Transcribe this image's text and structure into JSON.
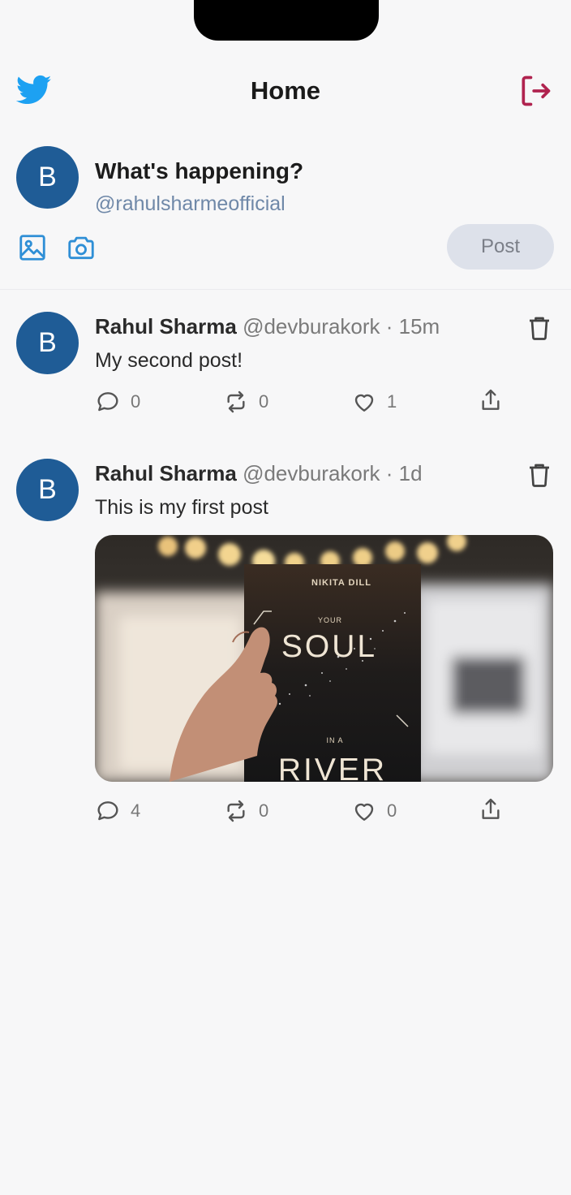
{
  "header": {
    "title": "Home",
    "logo_icon": "twitter-bird-icon",
    "logout_icon": "logout-icon",
    "accent_color": "#1da1f2",
    "logout_color": "#b0234f"
  },
  "composer": {
    "avatar_letter": "B",
    "prompt": "What's happening?",
    "handle": "@rahulsharmeofficial",
    "post_label": "Post",
    "tools": [
      "image-icon",
      "camera-icon"
    ]
  },
  "posts": [
    {
      "avatar_letter": "B",
      "name": "Rahul Sharma",
      "meta": "@devburakork · 15m",
      "text": "My second post!",
      "actions": {
        "comments": "0",
        "reposts": "0",
        "likes": "1"
      }
    },
    {
      "avatar_letter": "B",
      "name": "Rahul Sharma",
      "meta": "@devburakork · 1d",
      "text": "This is my first post",
      "image": {
        "author": "NIKITA DILL",
        "title_line1": "YOUR",
        "title_line2": "SOUL",
        "title_line3": "IN A",
        "title_line4": "RIVER"
      },
      "actions": {
        "comments": "4",
        "reposts": "0",
        "likes": "0"
      }
    }
  ]
}
